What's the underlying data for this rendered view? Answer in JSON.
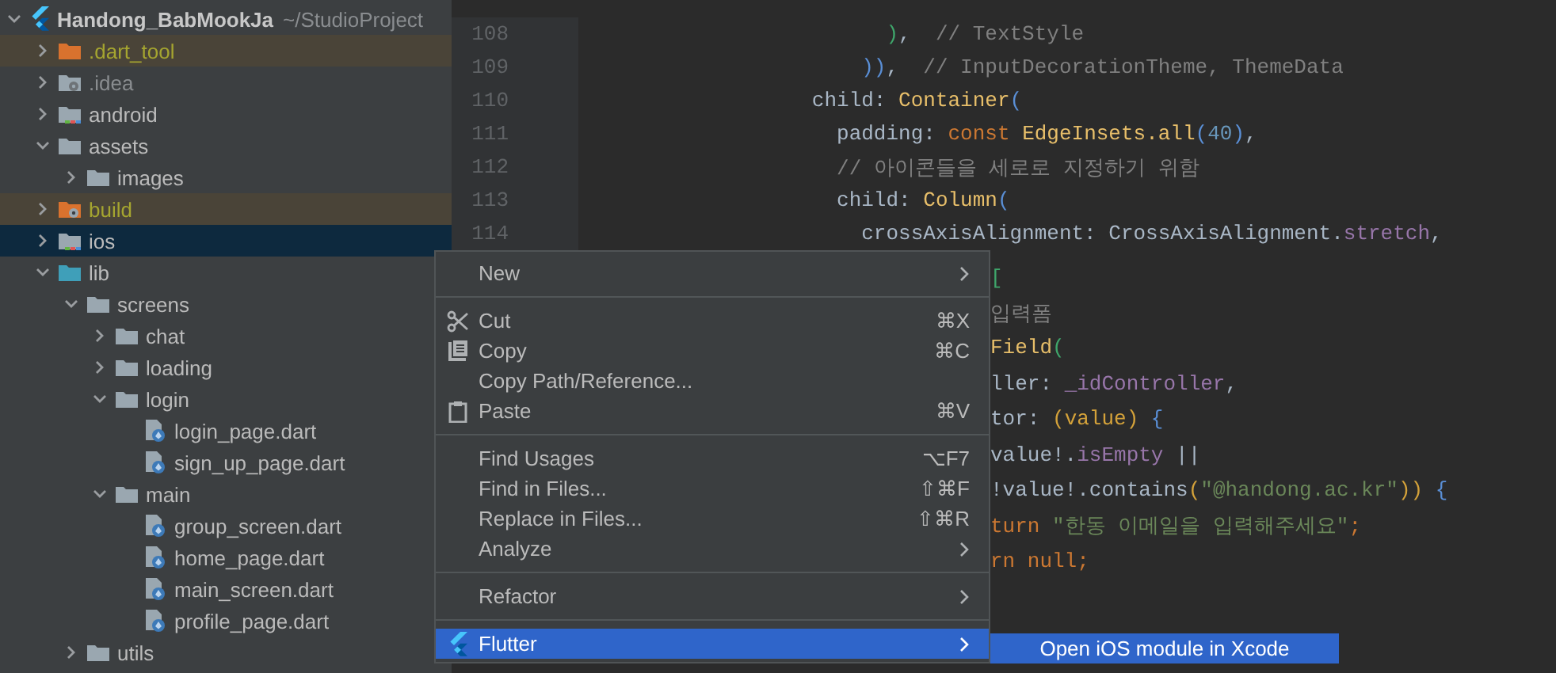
{
  "project_tree": {
    "root": {
      "name": "Handong_BabMookJa",
      "path": "~/StudioProject",
      "expanded": true,
      "selected": false,
      "children": [
        {
          "name": ".dart_tool",
          "kind": "excluded",
          "expanded": false,
          "selected": false
        },
        {
          "name": ".idea",
          "kind": "idea",
          "expanded": false,
          "selected": false
        },
        {
          "name": "android",
          "kind": "module",
          "expanded": false,
          "selected": false
        },
        {
          "name": "assets",
          "kind": "folder",
          "expanded": true,
          "selected": false,
          "children": [
            {
              "name": "images",
              "kind": "folder",
              "expanded": false,
              "selected": false
            }
          ]
        },
        {
          "name": "build",
          "kind": "excluded-output",
          "expanded": false,
          "selected": false
        },
        {
          "name": "ios",
          "kind": "module",
          "expanded": false,
          "selected": true
        },
        {
          "name": "lib",
          "kind": "source",
          "expanded": true,
          "selected": false,
          "children": [
            {
              "name": "screens",
              "kind": "folder",
              "expanded": true,
              "selected": false,
              "children": [
                {
                  "name": "chat",
                  "kind": "folder",
                  "expanded": false,
                  "selected": false
                },
                {
                  "name": "loading",
                  "kind": "folder",
                  "expanded": false,
                  "selected": false
                },
                {
                  "name": "login",
                  "kind": "folder",
                  "expanded": true,
                  "selected": false,
                  "children": [
                    {
                      "name": "login_page.dart",
                      "kind": "dart",
                      "selected": false
                    },
                    {
                      "name": "sign_up_page.dart",
                      "kind": "dart",
                      "selected": false
                    }
                  ]
                },
                {
                  "name": "main",
                  "kind": "folder",
                  "expanded": true,
                  "selected": false,
                  "children": [
                    {
                      "name": "group_screen.dart",
                      "kind": "dart",
                      "selected": false
                    },
                    {
                      "name": "home_page.dart",
                      "kind": "dart",
                      "selected": false
                    },
                    {
                      "name": "main_screen.dart",
                      "kind": "dart",
                      "selected": false
                    },
                    {
                      "name": "profile_page.dart",
                      "kind": "dart",
                      "selected": false
                    }
                  ]
                }
              ]
            },
            {
              "name": "utils",
              "kind": "folder",
              "expanded": false,
              "selected": false
            }
          ]
        }
      ]
    }
  },
  "editor": {
    "lines": [
      {
        "number": "108",
        "tokens": [
          {
            "kind": "paren-green",
            "text": "                        )"
          },
          {
            "kind": "plain",
            "text": ",  "
          },
          {
            "kind": "comment",
            "text": "// TextStyle"
          }
        ]
      },
      {
        "number": "109",
        "tokens": [
          {
            "kind": "paren-blue",
            "text": "                      ))"
          },
          {
            "kind": "plain",
            "text": ",  "
          },
          {
            "kind": "comment",
            "text": "// InputDecorationTheme, ThemeData"
          }
        ]
      },
      {
        "number": "110",
        "tokens": [
          {
            "kind": "plain",
            "text": "                  child: "
          },
          {
            "kind": "type",
            "text": "Container"
          },
          {
            "kind": "paren-blue",
            "text": "("
          }
        ]
      },
      {
        "number": "111",
        "tokens": [
          {
            "kind": "plain",
            "text": "                    padding: "
          },
          {
            "kind": "keyword",
            "text": "const "
          },
          {
            "kind": "type",
            "text": "EdgeInsets.all"
          },
          {
            "kind": "paren-blue",
            "text": "("
          },
          {
            "kind": "number",
            "text": "40"
          },
          {
            "kind": "paren-blue",
            "text": ")"
          },
          {
            "kind": "plain",
            "text": ","
          }
        ]
      },
      {
        "number": "112",
        "tokens": [
          {
            "kind": "comment",
            "text": "                    // 아이콘들을 세로로 지정하기 위함"
          }
        ]
      },
      {
        "number": "113",
        "tokens": [
          {
            "kind": "plain",
            "text": "                    child: "
          },
          {
            "kind": "type",
            "text": "Column"
          },
          {
            "kind": "paren-blue",
            "text": "("
          }
        ]
      },
      {
        "number": "114",
        "tokens": [
          {
            "kind": "plain",
            "text": "                      crossAxisAlignment: CrossAxisAlignment."
          },
          {
            "kind": "member",
            "text": "stretch"
          },
          {
            "kind": "plain",
            "text": ","
          }
        ]
      }
    ],
    "covered_lines": [
      {
        "tokens": [
          {
            "kind": "paren-green",
            "text": "["
          }
        ]
      },
      {
        "tokens": [
          {
            "kind": "comment",
            "text": "입력폼"
          }
        ]
      },
      {
        "tokens": [
          {
            "kind": "type",
            "text": "Field"
          },
          {
            "kind": "paren-green",
            "text": "("
          }
        ]
      },
      {
        "tokens": [
          {
            "kind": "plain",
            "text": "ller: "
          },
          {
            "kind": "member",
            "text": "_idController"
          },
          {
            "kind": "plain",
            "text": ","
          }
        ]
      },
      {
        "tokens": [
          {
            "kind": "plain",
            "text": "tor: "
          },
          {
            "kind": "param",
            "text": "(value)"
          },
          {
            "kind": "paren-blue",
            "text": " {"
          }
        ]
      },
      {
        "tokens": [
          {
            "kind": "plain",
            "text": "value!."
          },
          {
            "kind": "member",
            "text": "isEmpty"
          },
          {
            "kind": "plain",
            "text": " ||"
          }
        ]
      },
      {
        "tokens": [
          {
            "kind": "plain",
            "text": "!value!.contains"
          },
          {
            "kind": "param",
            "text": "("
          },
          {
            "kind": "string",
            "text": "\"@handong.ac.kr\""
          },
          {
            "kind": "param",
            "text": "))"
          },
          {
            "kind": "paren-blue",
            "text": " {"
          }
        ]
      },
      {
        "tokens": [
          {
            "kind": "keyword",
            "text": "turn "
          },
          {
            "kind": "string",
            "text": "\"한동 이메일을 입력해주세요\""
          },
          {
            "kind": "keyword",
            "text": ";"
          }
        ]
      },
      {
        "tokens": [
          {
            "kind": "keyword",
            "text": "rn null;"
          }
        ]
      }
    ]
  },
  "context_menu": {
    "items": [
      {
        "kind": "plain",
        "label": "New",
        "submenu": true,
        "selected": false
      },
      {
        "kind": "separator"
      },
      {
        "kind": "cut",
        "label": "Cut",
        "shortcut": "⌘X",
        "submenu": false,
        "selected": false
      },
      {
        "kind": "copy",
        "label": "Copy",
        "shortcut": "⌘C",
        "submenu": false,
        "selected": false
      },
      {
        "kind": "plain",
        "label": "Copy Path/Reference...",
        "submenu": false,
        "selected": false
      },
      {
        "kind": "paste",
        "label": "Paste",
        "shortcut": "⌘V",
        "submenu": false,
        "selected": false
      },
      {
        "kind": "separator"
      },
      {
        "kind": "plain",
        "label": "Find Usages",
        "shortcut": "⌥F7",
        "submenu": false,
        "selected": false
      },
      {
        "kind": "plain",
        "label": "Find in Files...",
        "shortcut": "⇧⌘F",
        "submenu": false,
        "selected": false
      },
      {
        "kind": "plain",
        "label": "Replace in Files...",
        "shortcut": "⇧⌘R",
        "submenu": false,
        "selected": false
      },
      {
        "kind": "plain",
        "label": "Analyze",
        "submenu": true,
        "selected": false
      },
      {
        "kind": "separator"
      },
      {
        "kind": "plain",
        "label": "Refactor",
        "submenu": true,
        "selected": false
      },
      {
        "kind": "separator"
      },
      {
        "kind": "flutter",
        "label": "Flutter",
        "submenu": true,
        "selected": true
      }
    ]
  },
  "submenu": {
    "items": [
      {
        "label": "Open iOS module in Xcode",
        "selected": true
      }
    ]
  }
}
